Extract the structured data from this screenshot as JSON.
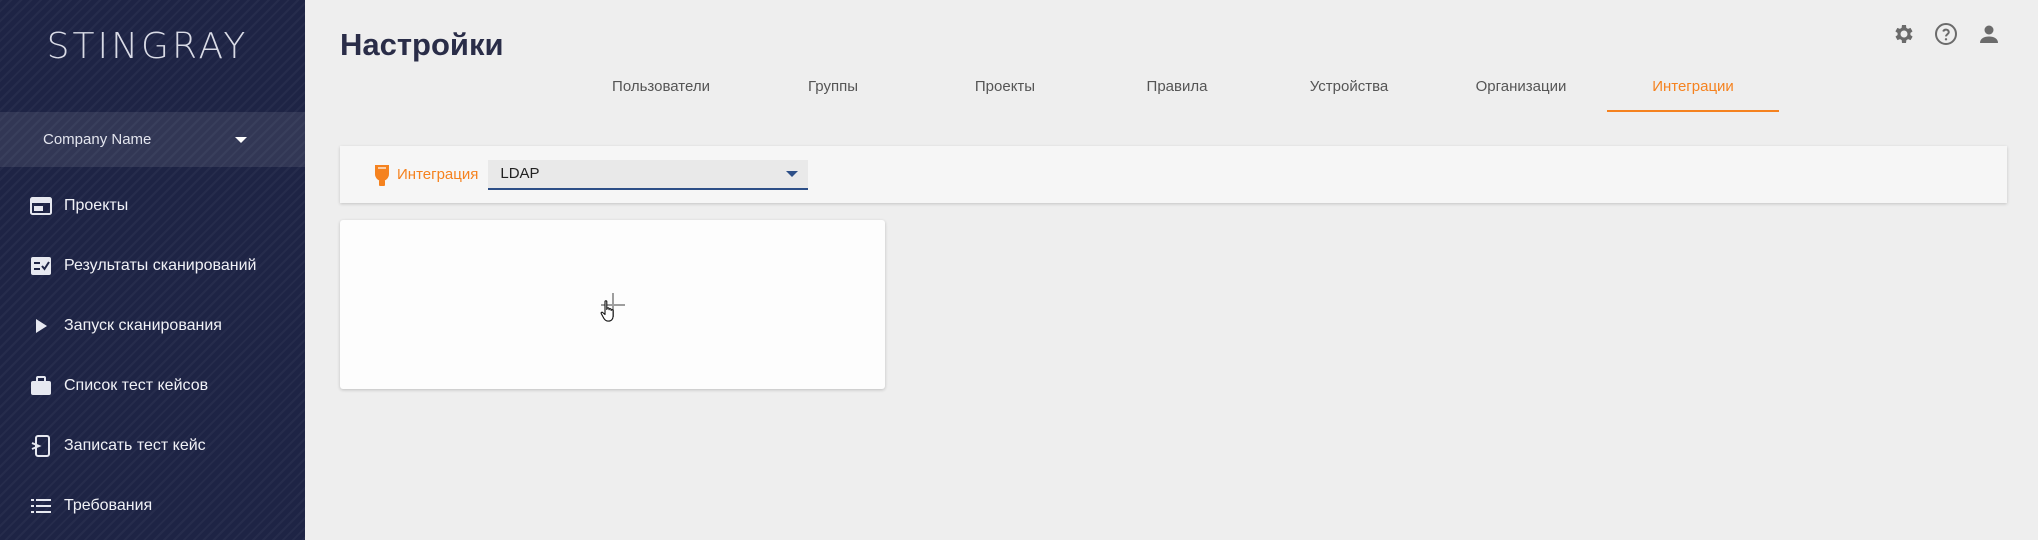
{
  "sidebar": {
    "logo": "STINGRAY",
    "company": {
      "label": "Company Name",
      "icon": "chevron-down-icon"
    },
    "items": [
      {
        "label": "Проекты",
        "icon": "projects-icon"
      },
      {
        "label": "Результаты сканирований",
        "icon": "scan-results-icon"
      },
      {
        "label": "Запуск сканирования",
        "icon": "play-icon"
      },
      {
        "label": "Список тест кейсов",
        "icon": "briefcase-icon"
      },
      {
        "label": "Записать тест кейс",
        "icon": "record-device-icon"
      },
      {
        "label": "Требования",
        "icon": "list-icon"
      }
    ]
  },
  "header": {
    "title": "Настройки",
    "icons": [
      "gear-icon",
      "help-icon",
      "user-icon"
    ]
  },
  "tabs": [
    {
      "label": "Пользователи",
      "active": false
    },
    {
      "label": "Группы",
      "active": false
    },
    {
      "label": "Проекты",
      "active": false
    },
    {
      "label": "Правила",
      "active": false
    },
    {
      "label": "Устройства",
      "active": false
    },
    {
      "label": "Организации",
      "active": false
    },
    {
      "label": "Интеграции",
      "active": true
    }
  ],
  "filter": {
    "label": "Интеграция",
    "icon": "integration-plug-icon",
    "select_value": "LDAP"
  },
  "add_card": {
    "icon": "plus-icon"
  },
  "colors": {
    "accent": "#f5821f",
    "sidebar_bg": "#1e2445",
    "select_underline": "#2d4f87",
    "page_bg": "#eeeeee"
  }
}
